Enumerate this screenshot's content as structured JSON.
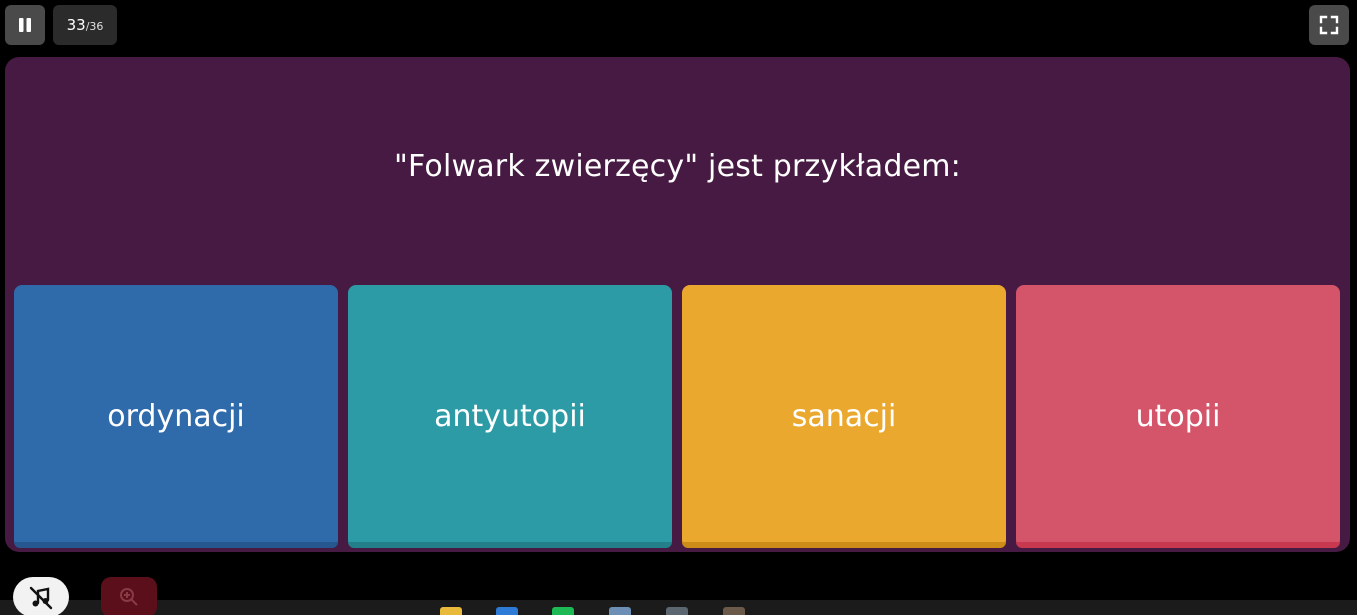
{
  "progress": {
    "current": "33",
    "separator": "/",
    "total": "36"
  },
  "question": "\"Folwark zwierzęcy\" jest przykładem:",
  "options": [
    {
      "label": "ordynacji",
      "color": "#2f6aaa",
      "shade": "#27578f"
    },
    {
      "label": "antyutopii",
      "color": "#2c9ba5",
      "shade": "#23808a"
    },
    {
      "label": "sanacji",
      "color": "#eaa82f",
      "shade": "#cc8c17"
    },
    {
      "label": "utopii",
      "color": "#d4546a",
      "shade": "#c8384f"
    }
  ],
  "colors": {
    "background": "#000000",
    "card": "#461a42",
    "button_dark": "#4a4a4a"
  },
  "icons": {
    "pause": "pause-icon",
    "fullscreen": "fullscreen-icon",
    "music_off": "music-off-icon",
    "zoom": "zoom-in-icon"
  }
}
